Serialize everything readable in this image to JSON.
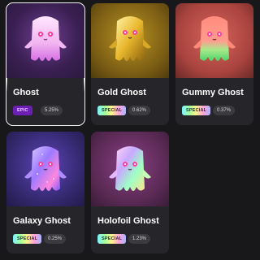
{
  "items": [
    {
      "name": "Ghost",
      "badge": "EPIC",
      "odds": "5.25%",
      "selected": true,
      "icon": "ghost-icon",
      "colors": {
        "bg": "#3a1f52",
        "body": "#f3c2ee",
        "accent": "#b65cff"
      }
    },
    {
      "name": "Gold Ghost",
      "badge": "SPECIAL",
      "odds": "0.62%",
      "selected": false,
      "icon": "gold-ghost-icon",
      "colors": {
        "bg": "#8c6d18",
        "body": "#f1c53c",
        "accent": "#3a2b05"
      }
    },
    {
      "name": "Gummy Ghost",
      "badge": "SPECIAL",
      "odds": "0.37%",
      "selected": false,
      "icon": "gummy-ghost-icon",
      "colors": {
        "bg": "#b34a45",
        "body": "#ff8a7a",
        "accent": "#78e07a"
      }
    },
    {
      "name": "Galaxy Ghost",
      "badge": "SPECIAL",
      "odds": "0.25%",
      "selected": false,
      "icon": "galaxy-ghost-icon",
      "colors": {
        "bg": "#3b2c78",
        "body": "#b07cff",
        "accent": "#ff76d8"
      }
    },
    {
      "name": "Holofoil Ghost",
      "badge": "SPECIAL",
      "odds": "1.23%",
      "selected": false,
      "icon": "holofoil-ghost-icon",
      "colors": {
        "bg": "#5c2a56",
        "body": "#f4c6ff",
        "accent": "#97ffbd"
      }
    }
  ]
}
